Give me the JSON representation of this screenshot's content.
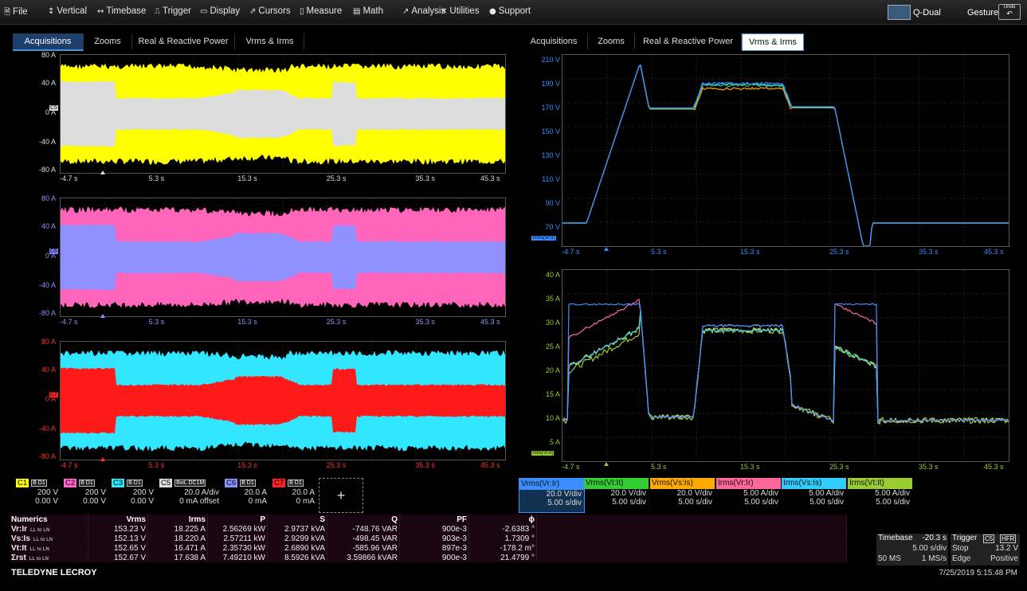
{
  "menu": [
    {
      "icon": "file-icon",
      "glyph": "🗎",
      "label": "File"
    },
    {
      "icon": "vertical-icon",
      "glyph": "↕",
      "label": "Vertical"
    },
    {
      "icon": "timebase-icon",
      "glyph": "↔",
      "label": "Timebase"
    },
    {
      "icon": "trigger-icon",
      "glyph": "⎍",
      "label": "Trigger"
    },
    {
      "icon": "display-icon",
      "glyph": "▭",
      "label": "Display"
    },
    {
      "icon": "cursors-icon",
      "glyph": "⇗",
      "label": "Cursors"
    },
    {
      "icon": "measure-icon",
      "glyph": "▯",
      "label": "Measure"
    },
    {
      "icon": "math-icon",
      "glyph": "▤",
      "label": "Math"
    },
    {
      "icon": "analysis-icon",
      "glyph": "↗",
      "label": "Analysis"
    },
    {
      "icon": "utilities-icon",
      "glyph": "✕",
      "label": "Utilities"
    },
    {
      "icon": "support-icon",
      "glyph": "●",
      "label": "Support"
    }
  ],
  "right_menu": {
    "layout": "Q-Dual",
    "gesture": "Gesture",
    "undo": "Undo"
  },
  "left_tabs": [
    "Acquisitions",
    "Zooms",
    "Real & Reactive Power",
    "Vrms & Irms"
  ],
  "right_tabs": [
    "Acquisitions",
    "Zooms",
    "Real & Reactive Power",
    "Vrms & Irms"
  ],
  "left_active_tab": "Acquisitions",
  "right_active_tab": "Vrms & Irms",
  "x_ticks": [
    "-4.7 s",
    "5.3 s",
    "15.3 s",
    "25.3 s",
    "35.3 s",
    "45.3 s"
  ],
  "current_ticks": [
    "80 A",
    "40 A",
    "0 A",
    "-40 A",
    "-80 A"
  ],
  "grid1_label": "C5",
  "grid2_label": "C6",
  "grid3_label": "C7",
  "vrms_ticks": [
    "210 V",
    "190 V",
    "170 V",
    "150 V",
    "130 V",
    "110 V",
    "90 V",
    "70 V"
  ],
  "irms_ticks": [
    "40 A",
    "35 A",
    "30 A",
    "25 A",
    "20 A",
    "15 A",
    "10 A",
    "5 A"
  ],
  "vrms_trace_label": "Vrms(Vr:Ir)",
  "irms_trace_label": "Irms(Vt:It)",
  "channels": [
    {
      "name": "C1",
      "color": "#ffff00",
      "tags": "B D1",
      "v1": "200 V",
      "v2": "0.00 V"
    },
    {
      "name": "C2",
      "color": "#ff66cc",
      "tags": "B D1",
      "v1": "200 V",
      "v2": "0.00 V"
    },
    {
      "name": "C3",
      "color": "#33e6ff",
      "tags": "B D1",
      "v1": "200 V",
      "v2": "0.00 V"
    },
    {
      "name": "C5",
      "color": "#dddddd",
      "tags": "BwL DC1M",
      "v1": "20.0 A/div",
      "v2": "0 mA offset"
    },
    {
      "name": "C6",
      "color": "#8f8fff",
      "tags": "B D1",
      "v1": "20.0 A",
      "v2": "0 mA"
    },
    {
      "name": "C7",
      "color": "#ff2020",
      "tags": "B D1",
      "v1": "20.0 A",
      "v2": "0 mA"
    }
  ],
  "add_channel": "+",
  "params": [
    {
      "name": "Vrms(Vr:Ir)",
      "color": "#3a8eff",
      "v1": "20.0 V/div",
      "v2": "5.00 s/div"
    },
    {
      "name": "Vrms(Vt:It)",
      "color": "#33cc33",
      "v1": "20.0 V/div",
      "v2": "5.00 s/div"
    },
    {
      "name": "Vrms(Vs:Is)",
      "color": "#ffaa00",
      "v1": "20.0 V/div",
      "v2": "5.00 s/div"
    },
    {
      "name": "Irms(Vr:Ir)",
      "color": "#ff6699",
      "v1": "5.00 A/div",
      "v2": "5.00 s/div"
    },
    {
      "name": "Irms(Vs:Is)",
      "color": "#33ccff",
      "v1": "5.00 A/div",
      "v2": "5.00 s/div"
    },
    {
      "name": "Irms(Vt:It)",
      "color": "#99cc33",
      "v1": "5.00 A/div",
      "v2": "5.00 s/div"
    }
  ],
  "numerics": {
    "title": "Numerics",
    "headers": [
      "Vrms",
      "Irms",
      "P",
      "S",
      "Q",
      "PF",
      "ϕ"
    ],
    "rows": [
      {
        "name": "Vr:Ir",
        "sub": "LL to LN",
        "vals": [
          "153.23 V",
          "18.225 A",
          "2.56269 kW",
          "2.9737 kVA",
          "-748.76 VAR",
          "900e-3",
          "-2.6383 °"
        ]
      },
      {
        "name": "Vs:Is",
        "sub": "LL to LN",
        "vals": [
          "152.13 V",
          "18.220 A",
          "2.57211 kW",
          "2.9299 kVA",
          "-498.45 VAR",
          "903e-3",
          "1.7309 °"
        ]
      },
      {
        "name": "Vt:It",
        "sub": "LL to LN",
        "vals": [
          "152.65 V",
          "16.471 A",
          "2.35730 kW",
          "2.6890 kVA",
          "-585.96 VAR",
          "897e-3",
          "-178.2 m°"
        ]
      },
      {
        "name": "Σrst",
        "sub": "LL to LN",
        "vals": [
          "152.67 V",
          "17.638 A",
          "7.49210 kW",
          "8.5926 kVA",
          "3.59866 kVAR",
          "900e-3",
          "21.4799 °"
        ]
      }
    ]
  },
  "timebase": {
    "label": "Timebase",
    "offset": "-20.3 s",
    "sdiv": "5.00 s/div",
    "samples": "50 MS",
    "rate": "1 MS/s"
  },
  "trigger": {
    "label": "Trigger",
    "src": "C5",
    "hfr": "HFR",
    "mode": "Stop",
    "level": "13.2 V",
    "type": "Edge",
    "slope": "Positive"
  },
  "brand": "TELEDYNE LECROY",
  "datetime": "7/25/2019 5:15:48 PM"
}
